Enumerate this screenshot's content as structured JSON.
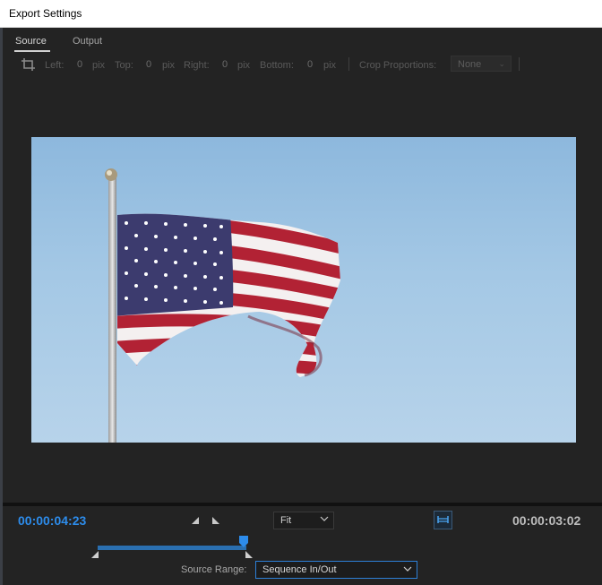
{
  "window": {
    "title": "Export Settings"
  },
  "tabs": [
    {
      "label": "Source",
      "active": true
    },
    {
      "label": "Output",
      "active": false
    }
  ],
  "crop": {
    "left_label": "Left:",
    "left_value": "0",
    "top_label": "Top:",
    "top_value": "0",
    "right_label": "Right:",
    "right_value": "0",
    "bottom_label": "Bottom:",
    "bottom_value": "0",
    "unit": "pix",
    "proportions_label": "Crop Proportions:",
    "proportions_value": "None"
  },
  "preview": {
    "subject": "American flag on flagpole against blue sky"
  },
  "transport": {
    "current_time": "00:00:04:23",
    "duration": "00:00:03:02",
    "zoom": "Fit",
    "playhead_fraction": 0.95
  },
  "source_range": {
    "label": "Source Range:",
    "value": "Sequence In/Out"
  },
  "colors": {
    "accent": "#2d8ceb",
    "panel": "#232323"
  },
  "icons": [
    "crop-icon",
    "prev-edit-icon",
    "next-edit-icon",
    "chevron-down-icon",
    "set-range-icon"
  ]
}
